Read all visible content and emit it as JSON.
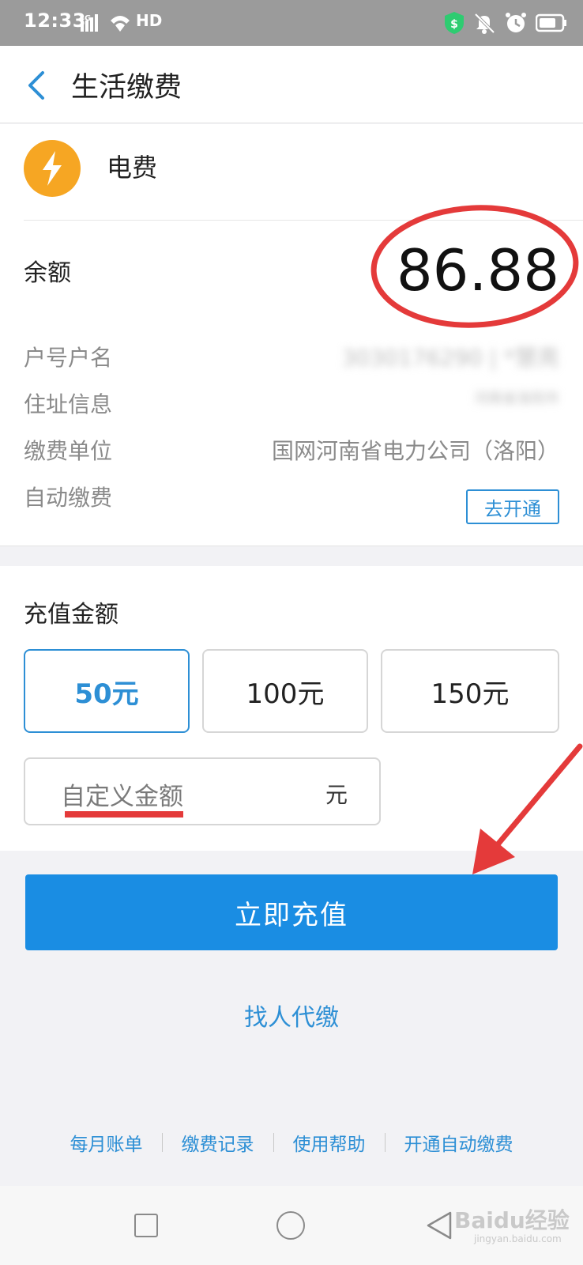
{
  "status_bar": {
    "time": "12:33",
    "network": "4G",
    "hd_label": "HD",
    "icons": [
      "shield-icon",
      "mute-icon",
      "alarm-icon",
      "battery-icon"
    ]
  },
  "header": {
    "back_icon": "chevron-left-icon",
    "title": "生活缴费"
  },
  "bill": {
    "icon": "lightning-icon",
    "icon_color": "#f6a623",
    "name": "电费",
    "balance_label": "余额",
    "balance_value": "86.88",
    "rows": [
      {
        "label": "户号户名",
        "value": "3030176290 | *慧亮"
      },
      {
        "label": "住址信息",
        "value": "河南省洛阳市"
      },
      {
        "label": "缴费单位",
        "value": "国网河南省电力公司（洛阳）"
      },
      {
        "label": "自动缴费",
        "action": "去开通"
      }
    ]
  },
  "recharge": {
    "title": "充值金额",
    "amounts": [
      {
        "label": "50元",
        "selected": true
      },
      {
        "label": "100元",
        "selected": false
      },
      {
        "label": "150元",
        "selected": false
      }
    ],
    "custom_placeholder": "自定义金额",
    "custom_unit": "元"
  },
  "cta_label": "立即充值",
  "proxy_link": "找人代缴",
  "footer_links": [
    "每月账单",
    "缴费记录",
    "使用帮助",
    "开通自动缴费"
  ],
  "watermark": {
    "text": "Baidu经验",
    "sub": "jingyan.baidu.com"
  },
  "colors": {
    "accent": "#1a8de3",
    "link": "#2d8fd5",
    "annotation": "#e43a3a"
  }
}
